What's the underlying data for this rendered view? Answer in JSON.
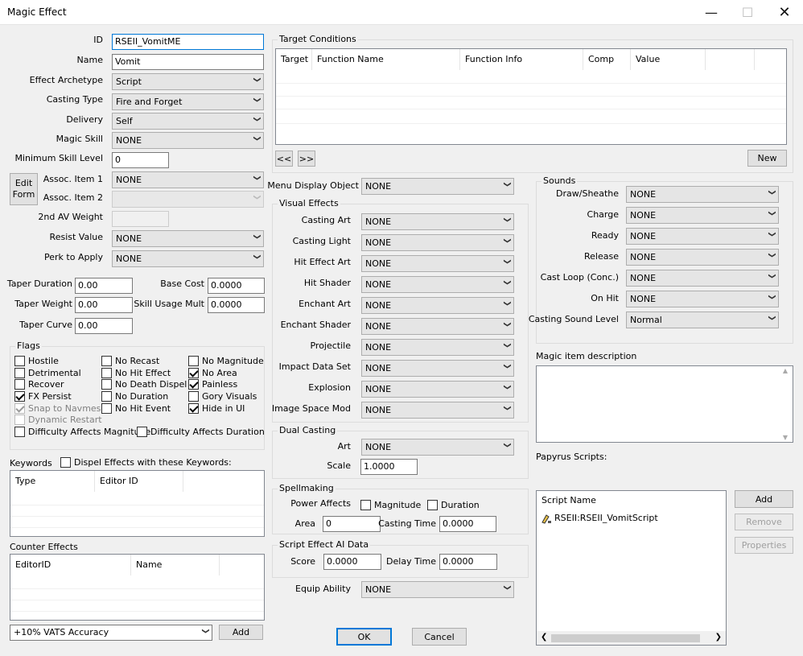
{
  "window": {
    "title": "Magic Effect"
  },
  "basic": {
    "id_label": "ID",
    "id_value": "RSEII_VomitME",
    "name_label": "Name",
    "name_value": "Vomit",
    "archetype_label": "Effect Archetype",
    "archetype_value": "Script",
    "casting_type_label": "Casting Type",
    "casting_type_value": "Fire and Forget",
    "delivery_label": "Delivery",
    "delivery_value": "Self",
    "magic_skill_label": "Magic Skill",
    "magic_skill_value": "NONE",
    "min_skill_label": "Minimum Skill Level",
    "min_skill_value": "0",
    "edit_form": "Edit Form",
    "assoc1_label": "Assoc. Item 1",
    "assoc1_value": "NONE",
    "assoc2_label": "Assoc. Item 2",
    "assoc2_value": "",
    "av2_label": "2nd AV Weight",
    "av2_value": "",
    "resist_label": "Resist Value",
    "resist_value": "NONE",
    "perk_label": "Perk to Apply",
    "perk_value": "NONE"
  },
  "taper": {
    "duration_label": "Taper Duration",
    "duration_value": "0.00",
    "weight_label": "Taper Weight",
    "weight_value": "0.00",
    "curve_label": "Taper Curve",
    "curve_value": "0.00",
    "base_cost_label": "Base Cost",
    "base_cost_value": "0.0000",
    "skill_mult_label": "Skill Usage Mult",
    "skill_mult_value": "0.0000"
  },
  "flags": {
    "title": "Flags",
    "items": [
      {
        "label": "Hostile",
        "checked": false
      },
      {
        "label": "No Recast",
        "checked": false
      },
      {
        "label": "No Magnitude",
        "checked": false
      },
      {
        "label": "Detrimental",
        "checked": false
      },
      {
        "label": "No Hit Effect",
        "checked": false
      },
      {
        "label": "No Area",
        "checked": true
      },
      {
        "label": "Recover",
        "checked": false
      },
      {
        "label": "No Death Dispel",
        "checked": false
      },
      {
        "label": "Painless",
        "checked": true
      },
      {
        "label": "FX Persist",
        "checked": true
      },
      {
        "label": "No Duration",
        "checked": false
      },
      {
        "label": "Gory Visuals",
        "checked": false
      },
      {
        "label": "Snap to Navmesh",
        "checked": true
      },
      {
        "label": "No Hit Event",
        "checked": false
      },
      {
        "label": "Hide in UI",
        "checked": true
      },
      {
        "label": "Dynamic Restart",
        "checked": false
      },
      {
        "label": "Difficulty Affects Magnitude",
        "checked": false
      },
      {
        "label": "Difficulty Affects Duration",
        "checked": false
      }
    ]
  },
  "keywords": {
    "label": "Keywords",
    "dispel_label": "Dispel Effects with these Keywords:",
    "columns": [
      "Type",
      "Editor ID"
    ]
  },
  "counter": {
    "label": "Counter Effects",
    "columns": [
      "EditorID",
      "Name"
    ],
    "combo_value": "+10% VATS Accuracy",
    "add_label": "Add"
  },
  "target": {
    "title": "Target Conditions",
    "columns": [
      "Target",
      "Function Name",
      "Function Info",
      "Comp",
      "Value",
      ""
    ],
    "prev": "<<",
    "next": ">>",
    "new_label": "New"
  },
  "menu_display": {
    "label": "Menu Display Object",
    "value": "NONE"
  },
  "visual": {
    "title": "Visual Effects",
    "items": [
      {
        "label": "Casting Art",
        "value": "NONE"
      },
      {
        "label": "Casting Light",
        "value": "NONE"
      },
      {
        "label": "Hit Effect Art",
        "value": "NONE"
      },
      {
        "label": "Hit Shader",
        "value": "NONE"
      },
      {
        "label": "Enchant Art",
        "value": "NONE"
      },
      {
        "label": "Enchant Shader",
        "value": "NONE"
      },
      {
        "label": "Projectile",
        "value": "NONE"
      },
      {
        "label": "Impact Data Set",
        "value": "NONE"
      },
      {
        "label": "Explosion",
        "value": "NONE"
      },
      {
        "label": "Image Space Mod",
        "value": "NONE"
      }
    ]
  },
  "dual": {
    "title": "Dual Casting",
    "art_label": "Art",
    "art_value": "NONE",
    "scale_label": "Scale",
    "scale_value": "1.0000"
  },
  "spell": {
    "title": "Spellmaking",
    "power_label": "Power Affects",
    "magnitude_label": "Magnitude",
    "duration_label": "Duration",
    "area_label": "Area",
    "area_value": "0",
    "casting_time_label": "Casting Time",
    "casting_time_value": "0.0000"
  },
  "ai": {
    "title": "Script Effect AI Data",
    "score_label": "Score",
    "score_value": "0.0000",
    "delay_label": "Delay Time",
    "delay_value": "0.0000"
  },
  "equip": {
    "label": "Equip Ability",
    "value": "NONE"
  },
  "sounds": {
    "title": "Sounds",
    "items": [
      {
        "label": "Draw/Sheathe",
        "value": "NONE"
      },
      {
        "label": "Charge",
        "value": "NONE"
      },
      {
        "label": "Ready",
        "value": "NONE"
      },
      {
        "label": "Release",
        "value": "NONE"
      },
      {
        "label": "Cast Loop (Conc.)",
        "value": "NONE"
      },
      {
        "label": "On Hit",
        "value": "NONE"
      },
      {
        "label": "Casting Sound Level",
        "value": "Normal"
      }
    ]
  },
  "description": {
    "label": "Magic item description",
    "value": ""
  },
  "papyrus": {
    "label": "Papyrus Scripts:",
    "column": "Script Name",
    "scripts": [
      "RSEII:RSEII_VomitScript"
    ],
    "add": "Add",
    "remove": "Remove",
    "properties": "Properties"
  },
  "footer": {
    "ok": "OK",
    "cancel": "Cancel"
  }
}
